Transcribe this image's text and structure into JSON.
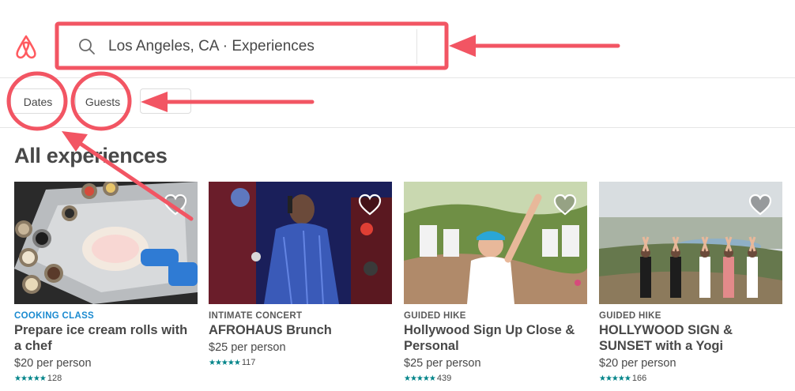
{
  "search": {
    "value": "Los Angeles, CA · Experiences"
  },
  "filters": [
    {
      "label": "Dates"
    },
    {
      "label": "Guests"
    },
    {
      "label": ""
    }
  ],
  "section": {
    "title": "All experiences"
  },
  "cards": [
    {
      "category": "COOKING CLASS",
      "title": "Prepare ice cream rolls with a chef",
      "price": "$20 per person",
      "rating_count": "128",
      "stars": "★★★★★"
    },
    {
      "category": "INTIMATE CONCERT",
      "title": "AFROHAUS Brunch",
      "price": "$25 per person",
      "rating_count": "117",
      "stars": "★★★★★"
    },
    {
      "category": "GUIDED HIKE",
      "title": "Hollywood Sign Up Close & Personal",
      "price": "$25 per person",
      "rating_count": "439",
      "stars": "★★★★★"
    },
    {
      "category": "GUIDED HIKE",
      "title": "HOLLYWOOD SIGN & SUNSET with a Yogi",
      "price": "$20 per person",
      "rating_count": "166",
      "stars": "★★★★★"
    }
  ],
  "colors": {
    "brand": "#ff5a5f",
    "annotation": "#f25563",
    "category_blue": "#1a8ad0",
    "stars": "#008489"
  },
  "icons": {
    "logo": "airbnb-logo",
    "search": "search-icon",
    "heart": "heart-icon"
  }
}
